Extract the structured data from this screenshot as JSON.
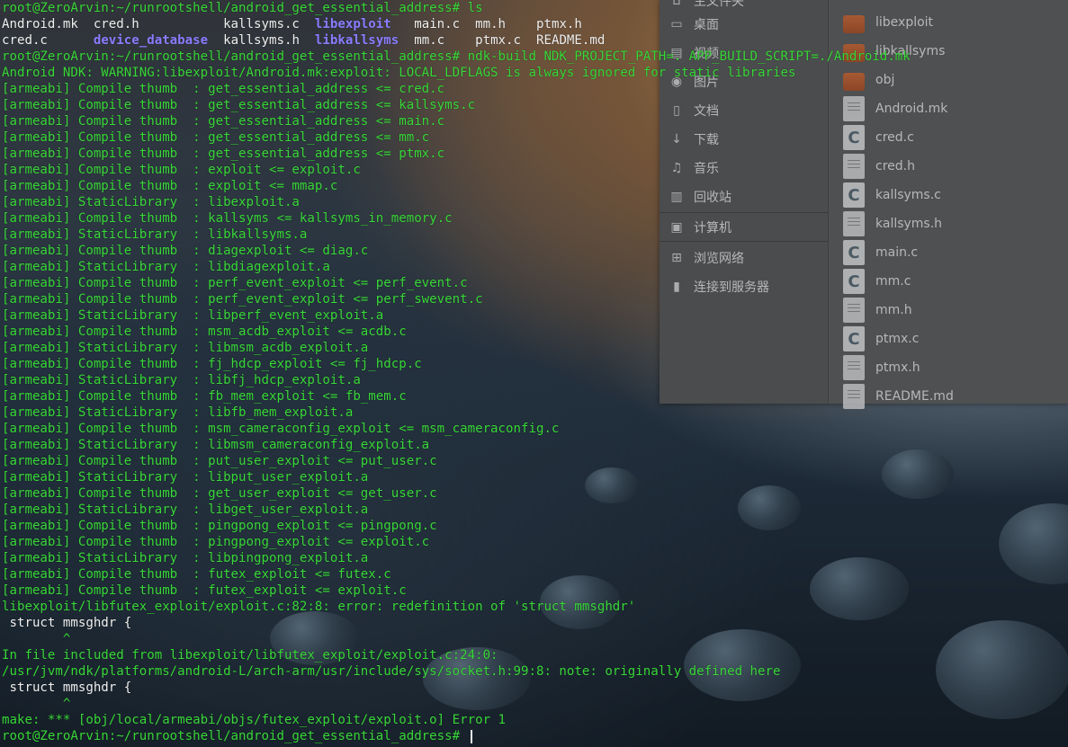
{
  "file_manager": {
    "sidebar": [
      {
        "label": "主文件夹",
        "icon": "home-icon"
      },
      {
        "label": "桌面",
        "icon": "desktop-icon"
      },
      {
        "label": "视频",
        "icon": "video-icon"
      },
      {
        "label": "图片",
        "icon": "pictures-icon"
      },
      {
        "label": "文档",
        "icon": "document-icon"
      },
      {
        "label": "下载",
        "icon": "download-icon"
      },
      {
        "label": "音乐",
        "icon": "music-icon"
      },
      {
        "label": "回收站",
        "icon": "trash-icon"
      },
      {
        "label": "计算机",
        "icon": "computer-icon"
      },
      {
        "label": "浏览网络",
        "icon": "network-icon"
      },
      {
        "label": "连接到服务器",
        "icon": "server-icon"
      }
    ],
    "files": [
      {
        "name": "libexploit",
        "type": "folder"
      },
      {
        "name": "libkallsyms",
        "type": "folder"
      },
      {
        "name": "obj",
        "type": "folder"
      },
      {
        "name": "Android.mk",
        "type": "text"
      },
      {
        "name": "cred.c",
        "type": "c"
      },
      {
        "name": "cred.h",
        "type": "text"
      },
      {
        "name": "kallsyms.c",
        "type": "c"
      },
      {
        "name": "kallsyms.h",
        "type": "text"
      },
      {
        "name": "main.c",
        "type": "c"
      },
      {
        "name": "mm.c",
        "type": "c"
      },
      {
        "name": "mm.h",
        "type": "text"
      },
      {
        "name": "ptmx.c",
        "type": "c"
      },
      {
        "name": "ptmx.h",
        "type": "text"
      },
      {
        "name": "README.md",
        "type": "text"
      }
    ]
  },
  "terminal": {
    "lines": [
      [
        {
          "t": "root@ZeroArvin:~/runrootshell/android_get_essential_address# ls",
          "c": ""
        }
      ],
      [
        {
          "t": "Android.mk  cred.h           kallsyms.c  ",
          "c": "w"
        },
        {
          "t": "libexploit",
          "c": "blue"
        },
        {
          "t": "   main.c  mm.h    ptmx.h",
          "c": "w"
        }
      ],
      [
        {
          "t": "cred.c      ",
          "c": "w"
        },
        {
          "t": "device_database",
          "c": "blue"
        },
        {
          "t": "  kallsyms.h  ",
          "c": "w"
        },
        {
          "t": "libkallsyms",
          "c": "blue"
        },
        {
          "t": "  mm.c    ptmx.c  README.md",
          "c": "w"
        }
      ],
      [
        {
          "t": "root@ZeroArvin:~/runrootshell/android_get_essential_address# ndk-build NDK_PROJECT_PATH=. APP_BUILD_SCRIPT=./Android.mk",
          "c": ""
        }
      ],
      [
        {
          "t": "Android NDK: WARNING:libexploit/Android.mk:exploit: LOCAL_LDFLAGS is always ignored for static libraries",
          "c": ""
        }
      ],
      [
        {
          "t": "[armeabi] Compile thumb  : get_essential_address <= cred.c",
          "c": ""
        }
      ],
      [
        {
          "t": "[armeabi] Compile thumb  : get_essential_address <= kallsyms.c",
          "c": ""
        }
      ],
      [
        {
          "t": "[armeabi] Compile thumb  : get_essential_address <= main.c",
          "c": ""
        }
      ],
      [
        {
          "t": "[armeabi] Compile thumb  : get_essential_address <= mm.c",
          "c": ""
        }
      ],
      [
        {
          "t": "[armeabi] Compile thumb  : get_essential_address <= ptmx.c",
          "c": ""
        }
      ],
      [
        {
          "t": "[armeabi] Compile thumb  : exploit <= exploit.c",
          "c": ""
        }
      ],
      [
        {
          "t": "[armeabi] Compile thumb  : exploit <= mmap.c",
          "c": ""
        }
      ],
      [
        {
          "t": "[armeabi] StaticLibrary  : libexploit.a",
          "c": ""
        }
      ],
      [
        {
          "t": "[armeabi] Compile thumb  : kallsyms <= kallsyms_in_memory.c",
          "c": ""
        }
      ],
      [
        {
          "t": "[armeabi] StaticLibrary  : libkallsyms.a",
          "c": ""
        }
      ],
      [
        {
          "t": "[armeabi] Compile thumb  : diagexploit <= diag.c",
          "c": ""
        }
      ],
      [
        {
          "t": "[armeabi] StaticLibrary  : libdiagexploit.a",
          "c": ""
        }
      ],
      [
        {
          "t": "[armeabi] Compile thumb  : perf_event_exploit <= perf_event.c",
          "c": ""
        }
      ],
      [
        {
          "t": "[armeabi] Compile thumb  : perf_event_exploit <= perf_swevent.c",
          "c": ""
        }
      ],
      [
        {
          "t": "[armeabi] StaticLibrary  : libperf_event_exploit.a",
          "c": ""
        }
      ],
      [
        {
          "t": "[armeabi] Compile thumb  : msm_acdb_exploit <= acdb.c",
          "c": ""
        }
      ],
      [
        {
          "t": "[armeabi] StaticLibrary  : libmsm_acdb_exploit.a",
          "c": ""
        }
      ],
      [
        {
          "t": "[armeabi] Compile thumb  : fj_hdcp_exploit <= fj_hdcp.c",
          "c": ""
        }
      ],
      [
        {
          "t": "[armeabi] StaticLibrary  : libfj_hdcp_exploit.a",
          "c": ""
        }
      ],
      [
        {
          "t": "[armeabi] Compile thumb  : fb_mem_exploit <= fb_mem.c",
          "c": ""
        }
      ],
      [
        {
          "t": "[armeabi] StaticLibrary  : libfb_mem_exploit.a",
          "c": ""
        }
      ],
      [
        {
          "t": "[armeabi] Compile thumb  : msm_cameraconfig_exploit <= msm_cameraconfig.c",
          "c": ""
        }
      ],
      [
        {
          "t": "[armeabi] StaticLibrary  : libmsm_cameraconfig_exploit.a",
          "c": ""
        }
      ],
      [
        {
          "t": "[armeabi] Compile thumb  : put_user_exploit <= put_user.c",
          "c": ""
        }
      ],
      [
        {
          "t": "[armeabi] StaticLibrary  : libput_user_exploit.a",
          "c": ""
        }
      ],
      [
        {
          "t": "[armeabi] Compile thumb  : get_user_exploit <= get_user.c",
          "c": ""
        }
      ],
      [
        {
          "t": "[armeabi] StaticLibrary  : libget_user_exploit.a",
          "c": ""
        }
      ],
      [
        {
          "t": "[armeabi] Compile thumb  : pingpong_exploit <= pingpong.c",
          "c": ""
        }
      ],
      [
        {
          "t": "[armeabi] Compile thumb  : pingpong_exploit <= exploit.c",
          "c": ""
        }
      ],
      [
        {
          "t": "[armeabi] StaticLibrary  : libpingpong_exploit.a",
          "c": ""
        }
      ],
      [
        {
          "t": "[armeabi] Compile thumb  : futex_exploit <= futex.c",
          "c": ""
        }
      ],
      [
        {
          "t": "[armeabi] Compile thumb  : futex_exploit <= exploit.c",
          "c": ""
        }
      ],
      [
        {
          "t": "libexploit/libfutex_exploit/exploit.c:82:8: error: redefinition of 'struct mmsghdr'",
          "c": ""
        }
      ],
      [
        {
          "t": " struct mmsghdr {",
          "c": "w"
        }
      ],
      [
        {
          "t": "        ^",
          "c": ""
        }
      ],
      [
        {
          "t": "In file included from libexploit/libfutex_exploit/exploit.c:24:0:",
          "c": ""
        }
      ],
      [
        {
          "t": "/usr/jvm/ndk/platforms/android-L/arch-arm/usr/include/sys/socket.h:99:8: note: originally defined here",
          "c": ""
        }
      ],
      [
        {
          "t": " struct mmsghdr {",
          "c": "w"
        }
      ],
      [
        {
          "t": "        ^",
          "c": ""
        }
      ],
      [
        {
          "t": "make: *** [obj/local/armeabi/objs/futex_exploit/exploit.o] Error 1",
          "c": ""
        }
      ],
      [
        {
          "t": "root@ZeroArvin:~/runrootshell/android_get_essential_address# ",
          "c": ""
        }
      ]
    ]
  }
}
